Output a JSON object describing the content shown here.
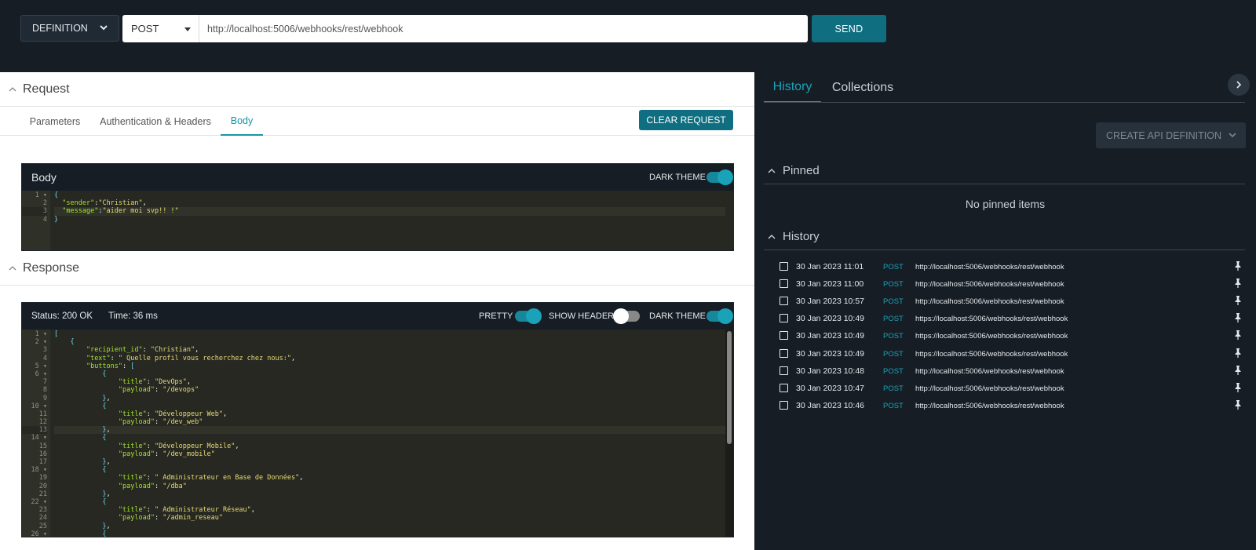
{
  "toolbar": {
    "definition_label": "DEFINITION",
    "method": "POST",
    "url": "http://localhost:5006/webhooks/rest/webhook",
    "send_label": "SEND"
  },
  "request": {
    "title": "Request",
    "tabs": [
      {
        "label": "Parameters",
        "active": false
      },
      {
        "label": "Authentication & Headers",
        "active": false
      },
      {
        "label": "Body",
        "active": true
      }
    ],
    "clear_label": "CLEAR REQUEST",
    "body_title": "Body",
    "dark_theme_label": "DARK THEME",
    "dark_theme_on": true,
    "body_lines": [
      "{",
      "  \"sender\":\"Christian\",",
      "  \"message\":\"aider moi svp!! !\"",
      "}"
    ]
  },
  "response": {
    "title": "Response",
    "status": "Status: 200 OK",
    "time": "Time: 36 ms",
    "pretty_label": "PRETTY",
    "pretty_on": true,
    "show_headers_label": "SHOW HEADERS",
    "show_headers_on": false,
    "dark_theme_label": "DARK THEME",
    "dark_theme_on": true,
    "lines": [
      "[",
      "    {",
      "        \"recipient_id\": \"Christian\",",
      "        \"text\": \" Quelle profil vous recherchez chez nous:\",",
      "        \"buttons\": [",
      "            {",
      "                \"title\": \"DevOps\",",
      "                \"payload\": \"/devops\"",
      "            },",
      "            {",
      "                \"title\": \"Développeur Web\",",
      "                \"payload\": \"/dev_web\"",
      "            },",
      "            {",
      "                \"title\": \"Développeur Mobile\",",
      "                \"payload\": \"/dev_mobile\"",
      "            },",
      "            {",
      "                \"title\": \" Administrateur en Base de Données\",",
      "                \"payload\": \"/dba\"",
      "            },",
      "            {",
      "                \"title\": \" Administrateur Réseau\",",
      "                \"payload\": \"/admin_reseau\"",
      "            },",
      "            {"
    ]
  },
  "sidebar": {
    "tabs": [
      {
        "label": "History",
        "active": true
      },
      {
        "label": "Collections",
        "active": false
      }
    ],
    "create_label": "CREATE API DEFINITION",
    "pinned_title": "Pinned",
    "no_pinned": "No pinned items",
    "history_title": "History",
    "history": [
      {
        "date": "30 Jan 2023 11:01",
        "method": "POST",
        "url": "http://localhost:5006/webhooks/rest/webhook"
      },
      {
        "date": "30 Jan 2023 11:00",
        "method": "POST",
        "url": "http://localhost:5006/webhooks/rest/webhook"
      },
      {
        "date": "30 Jan 2023 10:57",
        "method": "POST",
        "url": "http://localhost:5006/webhooks/rest/webhook"
      },
      {
        "date": "30 Jan 2023 10:49",
        "method": "POST",
        "url": "https://localhost:5006/webhooks/rest/webhook"
      },
      {
        "date": "30 Jan 2023 10:49",
        "method": "POST",
        "url": "https://localhost:5006/webhooks/rest/webhook"
      },
      {
        "date": "30 Jan 2023 10:49",
        "method": "POST",
        "url": "https://localhost:5006/webhooks/rest/webhook"
      },
      {
        "date": "30 Jan 2023 10:48",
        "method": "POST",
        "url": "http://localhost:5006/webhooks/rest/webhook"
      },
      {
        "date": "30 Jan 2023 10:47",
        "method": "POST",
        "url": "http://localhost:5006/webhooks/rest/webhook"
      },
      {
        "date": "30 Jan 2023 10:46",
        "method": "POST",
        "url": "http://localhost:5006/webhooks/rest/webhook"
      }
    ]
  }
}
